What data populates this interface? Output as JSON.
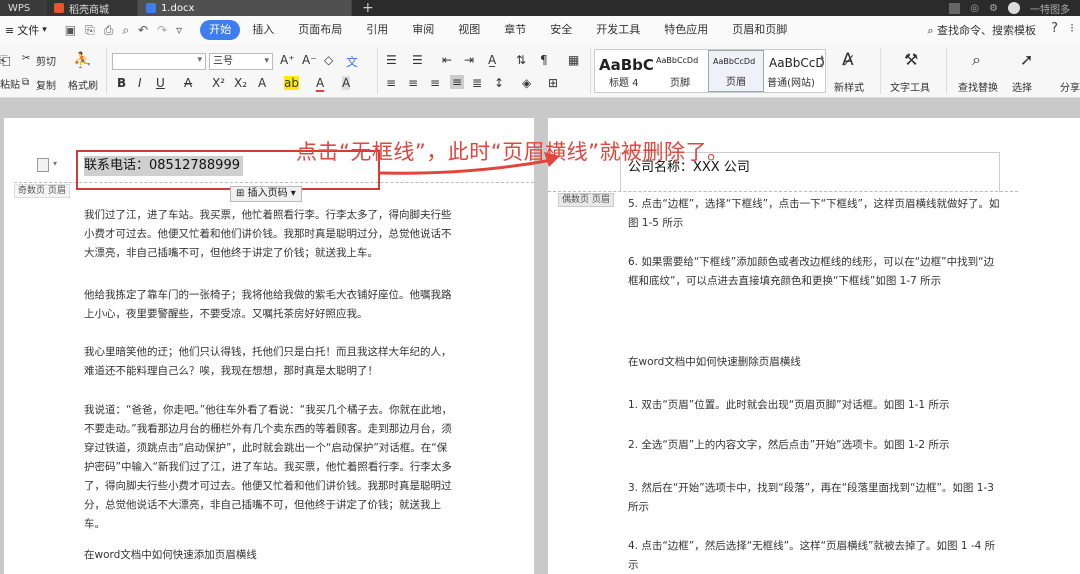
{
  "titlebar": {
    "tabs": [
      {
        "label": "WPS"
      },
      {
        "label": "稻壳商城"
      },
      {
        "label": "1.docx"
      }
    ],
    "new_tab": "+",
    "user_name": "一特图多"
  },
  "menubar": {
    "file_label": "文件",
    "items": [
      "开始",
      "插入",
      "页面布局",
      "引用",
      "审阅",
      "视图",
      "章节",
      "安全",
      "开发工具",
      "特色应用",
      "页眉和页脚"
    ],
    "search_label": "查找命令、搜索模板",
    "help_label": "?"
  },
  "ribbon": {
    "cut_label": "剪切",
    "paste_label": "粘贴",
    "copy_label": "复制",
    "format_brush_label": "格式刷",
    "font_name": "",
    "font_size": "三号",
    "styles": [
      {
        "sample": "AaBbC",
        "label": "标题 4"
      },
      {
        "sample": "AaBbCcDd",
        "label": "页脚"
      },
      {
        "sample": "AaBbCcDd",
        "label": "页眉"
      },
      {
        "sample": "AaBbCcD",
        "label": "普通(网站)"
      }
    ],
    "new_style_label": "新样式",
    "text_tools_label": "文字工具",
    "find_replace_label": "查找替换",
    "select_label": "选择",
    "share_label": "分享"
  },
  "left_page": {
    "header_text": "联系电话：08512788999",
    "odd_header_label": "奇数页 页眉",
    "insert_page_number": "插入页码",
    "paragraphs": [
      "我们过了江，进了车站。我买票，他忙着照看行李。行李太多了，得向脚夫行些小费才可过去。他便又忙着和他们讲价钱。我那时真是聪明过分，总觉他说话不大漂亮，非自己插嘴不可，但他终于讲定了价钱；就送我上车。",
      "他给我拣定了靠车门的一张椅子；我将他给我做的紫毛大衣铺好座位。他嘱我路上小心，夜里要警醒些，不要受凉。又嘱托茶房好好照应我。",
      "我心里暗笑他的迂；他们只认得钱，托他们只是白托！而且我这样大年纪的人，难道还不能料理自己么？唉，我现在想想，那时真是太聪明了！",
      "我说道：“爸爸，你走吧。”他往车外看了看说：“我买几个橘子去。你就在此地，不要走动。”我看那边月台的栅栏外有几个卖东西的等着顾客。走到那边月台，须穿过铁道，须跳点击“启动保护”，此时就会跳出一个“启动保护”对话框。在“保护密码”中输入“新我们过了江，进了车站。我买票，他忙着照看行李。行李太多了，得向脚夫行些小费才可过去。他便又忙着和他们讲价钱。我那时真是聪明过分，总觉他说话不大漂亮，非自己插嘴不可，但他终于讲定了价钱；就送我上车。",
      "在word文档中如何快速添加页眉横线"
    ]
  },
  "annotation": "点击“无框线”，此时“页眉横线”就被删除了。",
  "right_page": {
    "header_text": "公司名称：XXX 公司",
    "even_header_label": "偶数页 页眉",
    "paragraphs": [
      "5. 点击“边框”，选择“下框线”，点击一下“下框线”，这样页眉横线就做好了。如图 1-5 所示",
      "6. 如果需要给“下框线”添加颜色或者改边框线的线形，可以在“边框”中找到“边框和底纹”，可以点进去直接填充颜色和更换“下框线”如图 1-7 所示",
      "在word文档中如何快速删除页眉横线",
      "1. 双击“页眉”位置。此时就会出现“页眉页脚”对话框。如图 1-1 所示",
      "2. 全选“页眉”上的内容文字，然后点击”开始”选项卡。如图 1-2 所示",
      "3. 然后在“开始”选项卡中，找到“段落”，再在“段落里面找到“边框”。如图 1-3 所示",
      "4. 点击“边框”，然后选择“无框线”。这样“页眉横线”就被去掉了。如图 1 -4 所示"
    ]
  },
  "colors": {
    "accent": "#3d7df0",
    "annotation_red": "#e3443c",
    "highlight_box": "#d43b36"
  }
}
